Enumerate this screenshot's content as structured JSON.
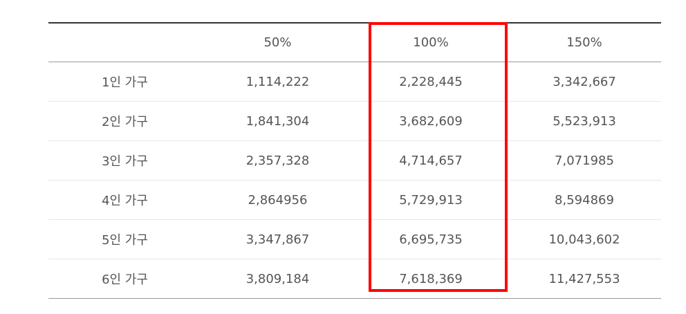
{
  "table": {
    "headers": [
      "",
      "50%",
      "100%",
      "150%"
    ],
    "rows": [
      [
        "1인 가구",
        "1,114,222",
        "2,228,445",
        "3,342,667"
      ],
      [
        "2인 가구",
        "1,841,304",
        "3,682,609",
        "5,523,913"
      ],
      [
        "3인 가구",
        "2,357,328",
        "4,714,657",
        "7,071985"
      ],
      [
        "4인 가구",
        "2,864956",
        "5,729,913",
        "8,594869"
      ],
      [
        "5인 가구",
        "3,347,867",
        "6,695,735",
        "10,043,602"
      ],
      [
        "6인 가구",
        "3,809,184",
        "7,618,369",
        "11,427,553"
      ]
    ]
  },
  "highlight": {
    "column": "100%",
    "color": "#ff0000"
  }
}
